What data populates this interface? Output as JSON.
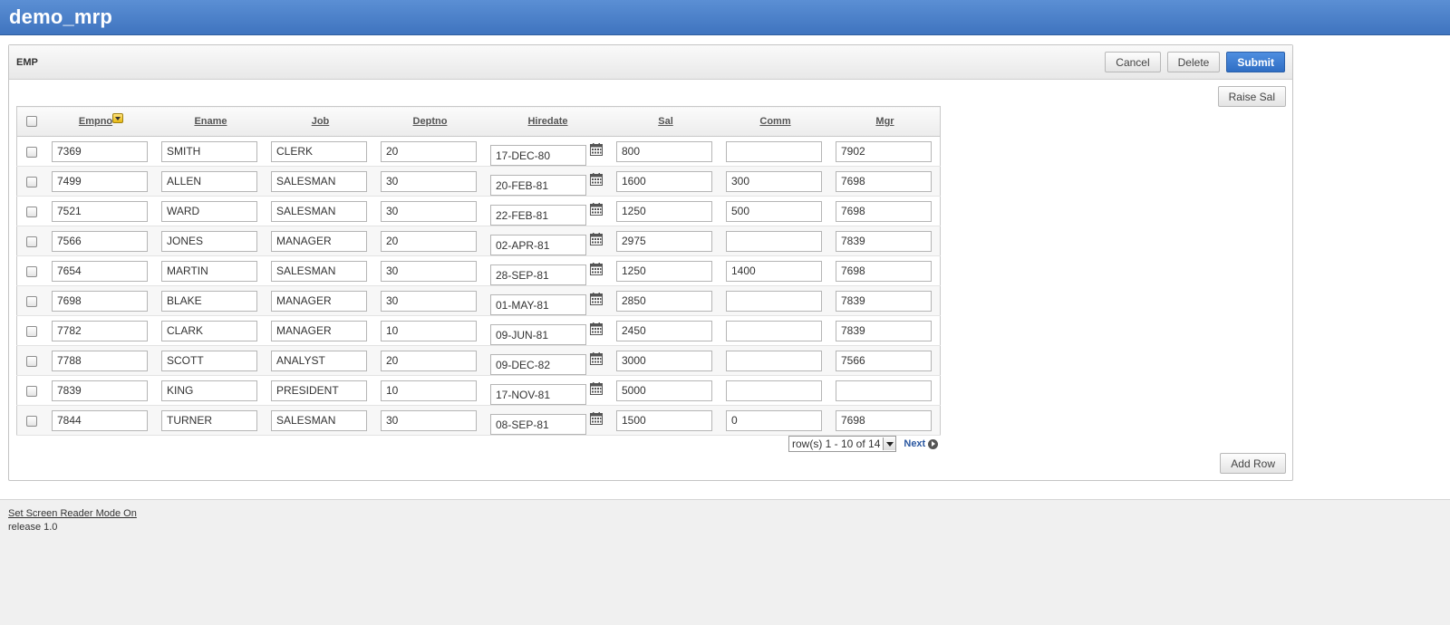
{
  "app": {
    "title": "demo_mrp"
  },
  "region": {
    "title": "EMP",
    "buttons": {
      "cancel": "Cancel",
      "delete": "Delete",
      "submit": "Submit",
      "raise_sal": "Raise Sal",
      "add_row": "Add Row"
    }
  },
  "grid": {
    "columns": [
      "Empno",
      "Ename",
      "Job",
      "Deptno",
      "Hiredate",
      "Sal",
      "Comm",
      "Mgr"
    ],
    "rows": [
      {
        "empno": "7369",
        "ename": "SMITH",
        "job": "CLERK",
        "deptno": "20",
        "hiredate": "17-DEC-80",
        "sal": "800",
        "comm": "",
        "mgr": "7902"
      },
      {
        "empno": "7499",
        "ename": "ALLEN",
        "job": "SALESMAN",
        "deptno": "30",
        "hiredate": "20-FEB-81",
        "sal": "1600",
        "comm": "300",
        "mgr": "7698"
      },
      {
        "empno": "7521",
        "ename": "WARD",
        "job": "SALESMAN",
        "deptno": "30",
        "hiredate": "22-FEB-81",
        "sal": "1250",
        "comm": "500",
        "mgr": "7698"
      },
      {
        "empno": "7566",
        "ename": "JONES",
        "job": "MANAGER",
        "deptno": "20",
        "hiredate": "02-APR-81",
        "sal": "2975",
        "comm": "",
        "mgr": "7839"
      },
      {
        "empno": "7654",
        "ename": "MARTIN",
        "job": "SALESMAN",
        "deptno": "30",
        "hiredate": "28-SEP-81",
        "sal": "1250",
        "comm": "1400",
        "mgr": "7698"
      },
      {
        "empno": "7698",
        "ename": "BLAKE",
        "job": "MANAGER",
        "deptno": "30",
        "hiredate": "01-MAY-81",
        "sal": "2850",
        "comm": "",
        "mgr": "7839"
      },
      {
        "empno": "7782",
        "ename": "CLARK",
        "job": "MANAGER",
        "deptno": "10",
        "hiredate": "09-JUN-81",
        "sal": "2450",
        "comm": "",
        "mgr": "7839"
      },
      {
        "empno": "7788",
        "ename": "SCOTT",
        "job": "ANALYST",
        "deptno": "20",
        "hiredate": "09-DEC-82",
        "sal": "3000",
        "comm": "",
        "mgr": "7566"
      },
      {
        "empno": "7839",
        "ename": "KING",
        "job": "PRESIDENT",
        "deptno": "10",
        "hiredate": "17-NOV-81",
        "sal": "5000",
        "comm": "",
        "mgr": ""
      },
      {
        "empno": "7844",
        "ename": "TURNER",
        "job": "SALESMAN",
        "deptno": "30",
        "hiredate": "08-SEP-81",
        "sal": "1500",
        "comm": "0",
        "mgr": "7698"
      }
    ]
  },
  "pager": {
    "range": "row(s) 1 - 10 of 14",
    "next": "Next"
  },
  "footer": {
    "screen_reader": "Set Screen Reader Mode On",
    "release": "release 1.0"
  },
  "colors": {
    "topbar": "#4a80c9",
    "primary_button": "#3a7bd5",
    "link": "#2a57a0"
  },
  "icons": {
    "calendar": "calendar-icon",
    "sort": "sort-desc-icon",
    "next": "next-arrow-icon"
  }
}
